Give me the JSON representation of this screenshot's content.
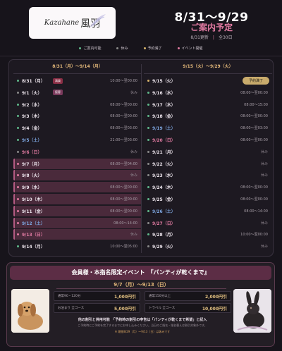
{
  "header": {
    "logo_text": "Kazahane",
    "logo_kanji": "風羽",
    "title": "8/31〜9/29",
    "subtitle": "ご案内予定",
    "updated": "8/31更新",
    "count": "全30日"
  },
  "legend": [
    {
      "label": "ご案内可能",
      "color": "#5fb88a"
    },
    {
      "label": "休み",
      "color": "#8a8a8a"
    },
    {
      "label": "予約満了",
      "color": "#d6b36a"
    },
    {
      "label": "イベント開催",
      "color": "#e07aa1"
    }
  ],
  "schedule": {
    "left_header": "8/31（月）〜9/14（月）",
    "right_header": "9/15（火）〜9/29（火）",
    "left": [
      {
        "date": "8/31（月）",
        "day": "weekday",
        "dot": "#5fb88a",
        "badge": "満員",
        "badge_style": "b-red",
        "status": "10:00〜翌00:00",
        "pink": false
      },
      {
        "date": "9/1（火）",
        "day": "weekday",
        "dot": "#8a8a8a",
        "badge": "接客",
        "badge_style": "b-pink",
        "status": "休み",
        "pink": false
      },
      {
        "date": "9/2（水）",
        "day": "weekday",
        "dot": "#5fb88a",
        "badge": "",
        "badge_style": "",
        "status": "08:00〜翌00:00",
        "pink": false
      },
      {
        "date": "9/3（木）",
        "day": "weekday",
        "dot": "#5fb88a",
        "badge": "",
        "badge_style": "",
        "status": "08:00〜翌00:00",
        "pink": false
      },
      {
        "date": "9/4（金）",
        "day": "weekday",
        "dot": "#5fb88a",
        "badge": "",
        "badge_style": "",
        "status": "08:00〜翌03:00",
        "pink": false
      },
      {
        "date": "9/5（土）",
        "day": "sat",
        "dot": "#5fb88a",
        "badge": "",
        "badge_style": "",
        "status": "21:00〜翌03:00",
        "pink": false
      },
      {
        "date": "9/6（日）",
        "day": "sun",
        "dot": "#8a8a8a",
        "badge": "",
        "badge_style": "",
        "status": "休み",
        "pink": false
      },
      {
        "date": "9/7（月）",
        "day": "weekday",
        "dot": "#e07aa1",
        "badge": "",
        "badge_style": "",
        "status": "08:00〜翌04:00",
        "pink": true
      },
      {
        "date": "9/8（火）",
        "day": "weekday",
        "dot": "#e07aa1",
        "badge": "",
        "badge_style": "",
        "status": "休み",
        "pink": true
      },
      {
        "date": "9/9（水）",
        "day": "weekday",
        "dot": "#e07aa1",
        "badge": "",
        "badge_style": "",
        "status": "08:00〜翌00:00",
        "pink": true
      },
      {
        "date": "9/10（木）",
        "day": "weekday",
        "dot": "#e07aa1",
        "badge": "",
        "badge_style": "",
        "status": "08:00〜翌00:00",
        "pink": true
      },
      {
        "date": "9/11（金）",
        "day": "weekday",
        "dot": "#e07aa1",
        "badge": "",
        "badge_style": "",
        "status": "08:00〜翌00:00",
        "pink": true
      },
      {
        "date": "9/12（土）",
        "day": "sat",
        "dot": "#e07aa1",
        "badge": "",
        "badge_style": "",
        "status": "08:00〜14:00",
        "pink": true
      },
      {
        "date": "9/13（日）",
        "day": "sun",
        "dot": "#e07aa1",
        "badge": "",
        "badge_style": "",
        "status": "休み",
        "pink": true
      },
      {
        "date": "9/14（月）",
        "day": "weekday",
        "dot": "#5fb88a",
        "badge": "",
        "badge_style": "",
        "status": "10:00〜翌05:00",
        "pink": false
      }
    ],
    "right": [
      {
        "date": "9/15（火）",
        "day": "weekday",
        "dot": "#d6b36a",
        "pill": "予約満了",
        "status": "",
        "pink": false
      },
      {
        "date": "9/16（水）",
        "day": "weekday",
        "dot": "#5fb88a",
        "pill": "",
        "status": "08:00〜翌00:00",
        "pink": false
      },
      {
        "date": "9/17（木）",
        "day": "weekday",
        "dot": "#5fb88a",
        "pill": "",
        "status": "08:00〜15:00",
        "pink": false
      },
      {
        "date": "9/18（金）",
        "day": "weekday",
        "dot": "#5fb88a",
        "pill": "",
        "status": "08:00〜翌00:00",
        "pink": false
      },
      {
        "date": "9/19（土）",
        "day": "sat",
        "dot": "#5fb88a",
        "pill": "",
        "status": "08:00〜翌03:00",
        "pink": false
      },
      {
        "date": "9/20（日）",
        "day": "sun",
        "dot": "#5fb88a",
        "pill": "",
        "status": "08:00〜翌00:00",
        "pink": false
      },
      {
        "date": "9/21（月）",
        "day": "weekday",
        "dot": "#8a8a8a",
        "pill": "",
        "status": "休み",
        "pink": false
      },
      {
        "date": "9/22（火）",
        "day": "weekday",
        "dot": "#8a8a8a",
        "pill": "",
        "status": "休み",
        "pink": false
      },
      {
        "date": "9/23（水）",
        "day": "weekday",
        "dot": "#8a8a8a",
        "pill": "",
        "status": "休み",
        "pink": false
      },
      {
        "date": "9/24（木）",
        "day": "weekday",
        "dot": "#5fb88a",
        "pill": "",
        "status": "08:00〜翌00:00",
        "pink": false
      },
      {
        "date": "9/25（金）",
        "day": "weekday",
        "dot": "#5fb88a",
        "pill": "",
        "status": "08:00〜翌00:00",
        "pink": false
      },
      {
        "date": "9/26（土）",
        "day": "sat",
        "dot": "#5fb88a",
        "pill": "",
        "status": "08:00〜14:00",
        "pink": false
      },
      {
        "date": "9/27（日）",
        "day": "sun",
        "dot": "#8a8a8a",
        "pill": "",
        "status": "休み",
        "pink": false
      },
      {
        "date": "9/28（月）",
        "day": "weekday",
        "dot": "#5fb88a",
        "pill": "",
        "status": "10:00〜翌00:00",
        "pink": false
      },
      {
        "date": "9/29（火）",
        "day": "weekday",
        "dot": "#8a8a8a",
        "pill": "",
        "status": "休み",
        "pink": false
      }
    ]
  },
  "promo": {
    "banner": "会員様・本指名限定イベント　『パンティが乾くまで』",
    "dates": "9/7（月）〜9/13（日）",
    "prices": [
      [
        {
          "label": "通常90・120分",
          "value": "1,000円引"
        },
        {
          "label": "通常150分以上",
          "value": "2,000円引"
        }
      ],
      [
        {
          "label": "お泊まり 全コース",
          "value": "5,000円引"
        },
        {
          "label": "トラベル 全コース",
          "value": "10,000円引"
        }
      ]
    ],
    "note1": "他の割引と併用可能　「予約時の割引の申告は「パンティが乾くまで希望」と記入",
    "note2": "ご予約時にご予約を完了するまでにお申し込みください。当日のご指名・指名替えは割引対象外です。",
    "note3": "※ 期間8/29（月）〜9/13（日）は休みです"
  }
}
